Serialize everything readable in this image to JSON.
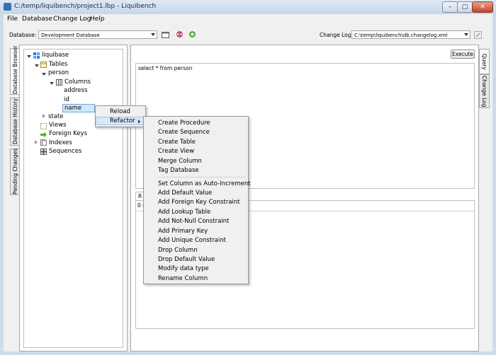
{
  "window": {
    "title": "C:/temp/liquibench/project1.lbp - Liquibench"
  },
  "menubar": [
    "File",
    "Database",
    "Change Log",
    "Help"
  ],
  "toolbar": {
    "database_label": "Database:",
    "database_value": "Development Database",
    "changelog_label": "Change Log:",
    "changelog_value": "C:\\temp\\liquibench\\db.changelog.xml"
  },
  "left_tabs": [
    "Database Browser",
    "Database History",
    "Pending Changes"
  ],
  "right_tabs": [
    "Query",
    "Change Log"
  ],
  "tree": {
    "root": "liquibase",
    "tables": "Tables",
    "person": "person",
    "columns": "Columns",
    "col_address": "address",
    "col_id": "id",
    "col_name": "name",
    "state": "state",
    "views": "Views",
    "foreign_keys": "Foreign Keys",
    "indexes": "Indexes",
    "sequences": "Sequences"
  },
  "query": {
    "execute_label": "Execute",
    "sql": "select * from person",
    "results_tab": "R",
    "results_text": "0 r"
  },
  "context_menu": {
    "reload": "Reload",
    "refactor": "Refactor"
  },
  "submenu": {
    "group1": [
      "Create Procedure",
      "Create Sequence",
      "Create Table",
      "Create View",
      "Merge Column",
      "Tag Database"
    ],
    "group2": [
      "Set Column as Auto-Increment",
      "Add Default Value",
      "Add Foreign Key Constraint",
      "Add Lookup Table",
      "Add Not-Null Constraint",
      "Add Primary Key",
      "Add Unique Constraint",
      "Drop Column",
      "Drop Default Value",
      "Modify data type",
      "Rename Column"
    ]
  },
  "colors": {
    "selection": "#cce8ff",
    "window_chrome": "#cfdbe8",
    "close_button": "#c5432a"
  }
}
